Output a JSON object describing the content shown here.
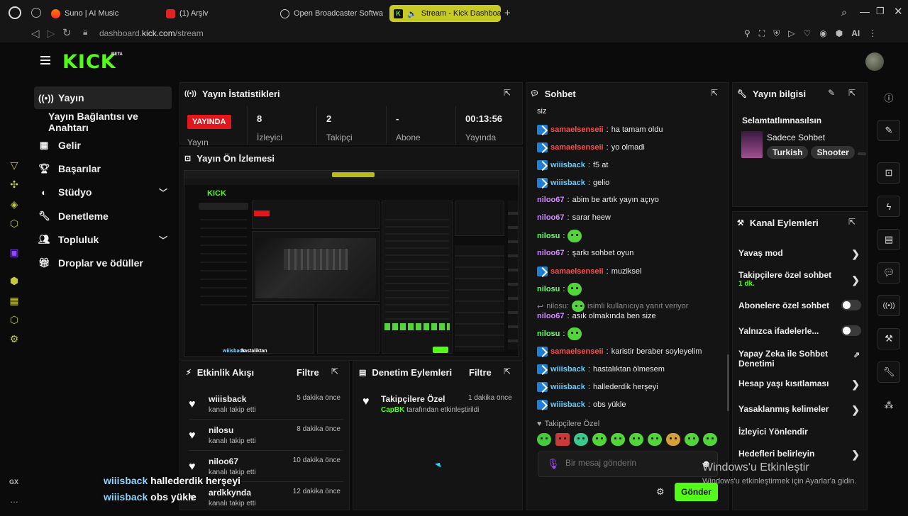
{
  "browser": {
    "tabs": [
      {
        "label": "Suno | AI Music"
      },
      {
        "label": "(1) Arşiv"
      },
      {
        "label": "Open Broadcaster Softwa"
      },
      {
        "label": "Stream - Kick Dashboa"
      }
    ],
    "url_prefix": "dashboard.",
    "url_domain": "kick.com",
    "url_path": "/stream",
    "ai_label": "AI",
    "gx_label": "GX"
  },
  "header": {
    "logo": "KICK",
    "beta": "BETA"
  },
  "nav": {
    "items": [
      {
        "label": "Yayın"
      },
      {
        "label": "Yayın Bağlantısı ve Anahtarı"
      },
      {
        "label": "Gelir"
      },
      {
        "label": "Başarılar"
      },
      {
        "label": "Stüdyo"
      },
      {
        "label": "Denetleme"
      },
      {
        "label": "Topluluk"
      },
      {
        "label": "Droplar ve ödüller"
      }
    ]
  },
  "stats": {
    "title": "Yayın İstatistikleri",
    "live": "YAYINDA",
    "status_label": "Yayın",
    "viewers": {
      "value": "8",
      "label": "İzleyici"
    },
    "followers": {
      "value": "2",
      "label": "Takipçi"
    },
    "subs": {
      "value": "-",
      "label": "Abone"
    },
    "uptime": {
      "value": "00:13:56",
      "label": "Yayında"
    }
  },
  "preview": {
    "title": "Yayın Ön İzlemesi",
    "overlay1": "wiiisback",
    "overlay2": "hastaliktan"
  },
  "activity": {
    "title": "Etkinlik Akışı",
    "filter": "Filtre",
    "items": [
      {
        "name": "wiiisback",
        "sub": "kanalı takip etti",
        "time": "5 dakika önce"
      },
      {
        "name": "nilosu",
        "sub": "kanalı takip etti",
        "time": "8 dakika önce"
      },
      {
        "name": "niloo67",
        "sub": "kanalı takip etti",
        "time": "10 dakika önce"
      },
      {
        "name": "ardkkynda",
        "sub": "kanalı takip etti",
        "time": "12 dakika önce"
      }
    ]
  },
  "moderation": {
    "title": "Denetim Eylemleri",
    "filter": "Filtre",
    "item_title": "Takipçilere Özel",
    "item_time": "1 dakika önce",
    "item_user": "CapBK",
    "item_sub": "tarafından etkinleştirildi"
  },
  "chat": {
    "title": "Sohbet",
    "first": "siz",
    "messages": [
      {
        "user": "samaelsenseii",
        "text": "ha tamam oldu",
        "color": "#ff4d4d",
        "badge": true
      },
      {
        "user": "samaelsenseii",
        "text": "yo olmadi",
        "color": "#ff4d4d",
        "badge": true
      },
      {
        "user": "wiiisback",
        "text": "f5 at",
        "color": "#66ccff",
        "badge": true
      },
      {
        "user": "wiiisback",
        "text": "gelio",
        "color": "#66ccff",
        "badge": true
      },
      {
        "user": "niloo67",
        "text": "abim be artık yayın açıyo",
        "color": "#d08cff",
        "badge": false
      },
      {
        "user": "niloo67",
        "text": "sarar heew",
        "color": "#d08cff",
        "badge": false
      },
      {
        "user": "nilosu",
        "text": "",
        "color": "#66ff66",
        "badge": false,
        "emote": true
      },
      {
        "user": "niloo67",
        "text": "şarkı sohbet oyun",
        "color": "#d08cff",
        "badge": false
      },
      {
        "user": "samaelsenseii",
        "text": "muziksel",
        "color": "#ff4d4d",
        "badge": true
      },
      {
        "user": "nilosu",
        "text": "",
        "color": "#66ff66",
        "badge": false,
        "emote": true
      }
    ],
    "reply_user": "nilosu:",
    "reply_text": "isimli kullanıcıya yanıt veriyor",
    "messages2": [
      {
        "user": "niloo67",
        "text": "asık olmakında ben size",
        "color": "#d08cff",
        "badge": false
      },
      {
        "user": "nilosu",
        "text": "",
        "color": "#66ff66",
        "badge": false,
        "emote": true
      },
      {
        "user": "samaelsenseii",
        "text": "karistir beraber soyleyelim",
        "color": "#ff4d4d",
        "badge": true
      },
      {
        "user": "wiiisback",
        "text": "hastalıktan ölmesem",
        "color": "#66ccff",
        "badge": true
      },
      {
        "user": "wiiisback",
        "text": "hallederdik herşeyi",
        "color": "#66ccff",
        "badge": true
      },
      {
        "user": "wiiisback",
        "text": "obs yükle",
        "color": "#66ccff",
        "badge": true
      }
    ],
    "followers_only": "Takipçilere Özel",
    "placeholder": "Bir mesaj gönderin",
    "send": "Gönder"
  },
  "stream_info": {
    "title": "Yayın bilgisi",
    "stream_title": "Selamtatlımnasılsın",
    "category": "Sadece Sohbet",
    "tags": [
      "Turkish",
      "Shooter"
    ]
  },
  "channel_actions": {
    "title": "Kanal Eylemleri",
    "slow_mode": "Yavaş mod",
    "followers_chat": "Takipçilere özel sohbet",
    "followers_chat_sub": "1 dk.",
    "subs_chat": "Abonelere özel sohbet",
    "emotes_only": "Yalnızca ifadelerle...",
    "ai_mod": "Yapay Zeka ile Sohbet Denetimi",
    "age": "Hesap yaşı kısıtlaması",
    "banned": "Yasaklanmış kelimeler",
    "raid": "İzleyici Yönlendir",
    "goals": "Hedefleri belirleyin"
  },
  "windows": {
    "line1": "Windows'u Etkinleştir",
    "line2": "Windows'u etkinleştirmek için Ayarlar'a gidin."
  },
  "overlay": {
    "user1": "wiiisback",
    "msg1": "hallederdik herşeyi",
    "user2": "wiiisback",
    "msg2": "obs yükle"
  }
}
